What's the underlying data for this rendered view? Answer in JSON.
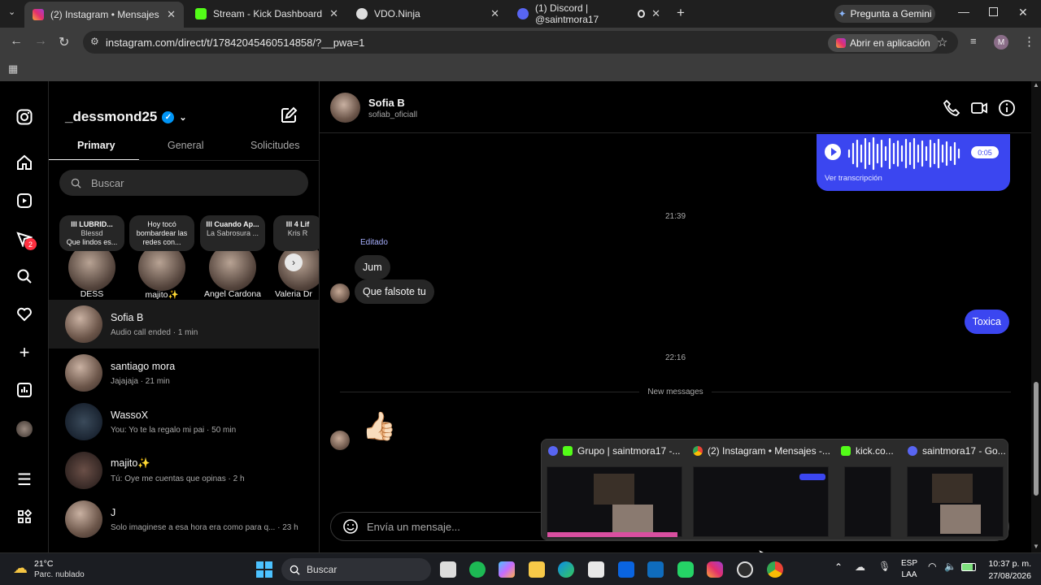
{
  "browser": {
    "tabs": [
      {
        "label": "(2) Instagram • Mensajes",
        "active": true,
        "icon": "instagram-icon"
      },
      {
        "label": "Stream - Kick Dashboard",
        "active": false,
        "icon": "kick-icon"
      },
      {
        "label": "VDO.Ninja",
        "active": false,
        "icon": "vdo-ninja-icon"
      },
      {
        "label": "(1) Discord | @saintmora17",
        "active": false,
        "icon": "discord-icon"
      }
    ],
    "gemini": "Pregunta a Gemini",
    "url": "instagram.com/direct/t/17842045460514858/?__pwa=1",
    "open_app": "Abrir en aplicación",
    "profile_initial": "M"
  },
  "nav": {
    "notif_badge": "2"
  },
  "inbox": {
    "username": "_dessmond25",
    "tabs": [
      "Primary",
      "General",
      "Solicitudes"
    ],
    "search_placeholder": "Buscar",
    "notes": [
      {
        "title": "Ill LUBRID...",
        "sub": "Blessd",
        "text": "Que lindos es...",
        "name": "DESS"
      },
      {
        "title": "Hoy tocó",
        "sub": "bombardear las",
        "text": "redes con...",
        "name": "majito✨"
      },
      {
        "title": "Ill Cuando Ap...",
        "sub": "La Sabrosura ...",
        "text": "",
        "name": "Angel Cardona"
      },
      {
        "title": "Ill 4 Lif",
        "sub": "Kris R",
        "text": "",
        "name": "Valeria Dr"
      }
    ],
    "threads": [
      {
        "name": "Sofia B",
        "preview": "Audio call ended · 1 min"
      },
      {
        "name": "santiago mora",
        "preview": "Jajajaja · 21 min"
      },
      {
        "name": "WassoX",
        "preview": "You: Yo te la regalo mi pai · 50 min"
      },
      {
        "name": "majito✨",
        "preview": "Tú: Oye me cuentas que opinas · 2 h"
      },
      {
        "name": "J",
        "preview": "Solo imaginese a esa hora era como para q... · 23 h"
      }
    ]
  },
  "chat": {
    "name": "Sofia B",
    "handle": "sofiab_oficiall",
    "audio_duration": "0:05",
    "transcription": "Ver transcripción",
    "time1": "21:39",
    "edited": "Editado",
    "msg1": "Jum",
    "msg2": "Que falsote tu",
    "msg3": "Toxica",
    "time2": "22:16",
    "new_messages": "New messages",
    "emoji": "👍🏻",
    "composer_placeholder": "Envía un mensaje..."
  },
  "preview": {
    "items": [
      "Grupo | saintmora17 -...",
      "(2) Instagram • Mensajes -...",
      "kick.co...",
      "saintmora17 - Go..."
    ]
  },
  "taskbar": {
    "temp": "21°C",
    "weather": "Parc. nublado",
    "search": "Buscar",
    "lang1": "ESP",
    "lang2": "LAA",
    "time": "10:37 p. m.",
    "date": "27/08/2026"
  },
  "colors": {
    "accent": "#3b46f0",
    "verified": "#0095f6",
    "badge": "#ff3040"
  }
}
